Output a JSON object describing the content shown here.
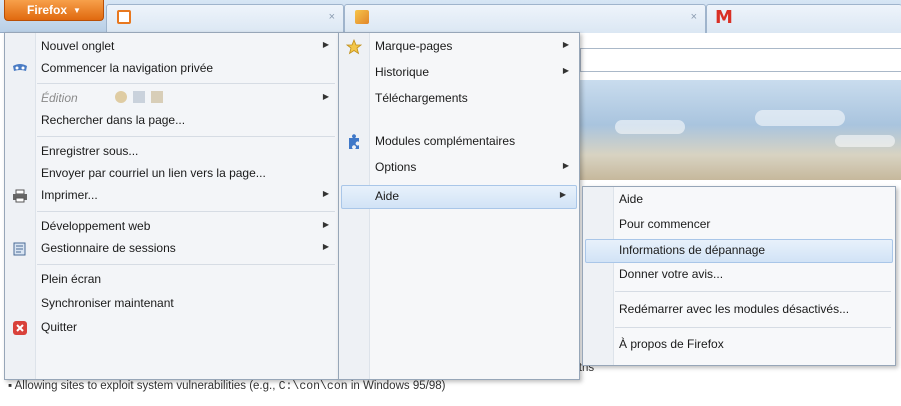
{
  "firefox_button": {
    "label": "Firefox",
    "caret": "▼"
  },
  "tabs": [
    {
      "favicon": "calendar-icon",
      "close": "×"
    },
    {
      "favicon": "page-icon",
      "close": "×"
    },
    {
      "favicon": "gmail-icon",
      "glyph": "M"
    }
  ],
  "main_menu": {
    "items": [
      {
        "label": "Nouvel onglet",
        "submenu": true
      },
      {
        "label": "Commencer la navigation privée",
        "icon": "private-mask-icon"
      },
      {
        "label": "Édition",
        "submenu": true,
        "disabled": true
      },
      {
        "label": "Rechercher dans la page..."
      },
      {
        "label": "Enregistrer sous..."
      },
      {
        "label": "Envoyer par courriel un lien vers la page..."
      },
      {
        "label": "Imprimer...",
        "submenu": true,
        "icon": "printer-icon"
      },
      {
        "label": "Développement web",
        "submenu": true
      },
      {
        "label": "Gestionnaire de sessions",
        "submenu": true,
        "icon": "session-manager-icon"
      },
      {
        "label": "Plein écran"
      },
      {
        "label": "Synchroniser maintenant"
      },
      {
        "label": "Quitter",
        "icon": "quit-icon"
      }
    ]
  },
  "second_menu": {
    "items": [
      {
        "label": "Marque-pages",
        "submenu": true,
        "icon": "star-icon"
      },
      {
        "label": "Historique",
        "submenu": true
      },
      {
        "label": "Téléchargements"
      },
      {
        "label": "Modules complémentaires",
        "icon": "puzzle-icon"
      },
      {
        "label": "Options",
        "submenu": true
      },
      {
        "label": "Aide",
        "submenu": true,
        "highlighted": true
      }
    ]
  },
  "help_menu": {
    "items": [
      {
        "label": "Aide"
      },
      {
        "label": "Pour commencer"
      },
      {
        "label": "Informations de dépannage",
        "highlighted": true
      },
      {
        "label": "Donner votre avis..."
      },
      {
        "label": "Redémarrer avec les modules désactivés..."
      },
      {
        "label": "À propos de Firefox"
      }
    ]
  },
  "background_page": {
    "fragment": "paths",
    "line_prefix": "Allowing sites to exploit system vulnerabilities (e.g., ",
    "line_code": "C:\\con\\con",
    "line_suffix": " in Windows 95/98)"
  },
  "colors": {
    "firefox_orange": "#e8781f",
    "highlight": "#d2e3f6",
    "menu_bg": "#f3f5f8"
  }
}
